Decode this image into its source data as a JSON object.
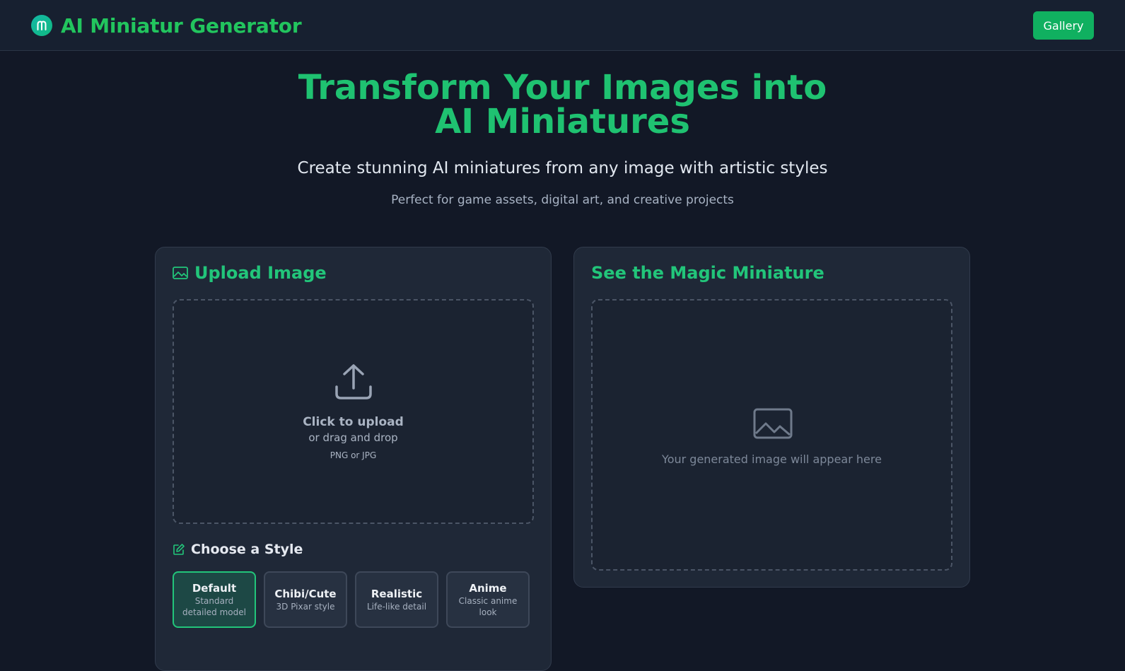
{
  "header": {
    "logo_icon": "m-logo-icon",
    "title": "AI Miniatur Generator",
    "gallery_label": "Gallery"
  },
  "hero": {
    "title_line1": "Transform Your Images into",
    "title_line2": "AI Miniatures",
    "subtitle": "Create stunning AI miniatures from any image with artistic styles",
    "tagline": "Perfect for game assets, digital art, and creative projects"
  },
  "upload_card": {
    "heading": "Upload Image",
    "heading_icon": "image-icon",
    "dropzone": {
      "icon": "upload-icon",
      "main_text": "Click to upload",
      "sub_text": "or drag and drop",
      "hint": "PNG or JPG"
    },
    "style_heading": "Choose a Style",
    "style_heading_icon": "edit-icon",
    "styles": [
      {
        "name": "Default",
        "desc": "Standard detailed model",
        "selected": true
      },
      {
        "name": "Chibi/Cute",
        "desc": "3D Pixar style",
        "selected": false
      },
      {
        "name": "Realistic",
        "desc": "Life-like detail",
        "selected": false
      },
      {
        "name": "Anime",
        "desc": "Classic anime look",
        "selected": false
      }
    ]
  },
  "result_card": {
    "heading_prefix": "See the ",
    "heading_highlight": "Magic Miniature",
    "placeholder_icon": "image-placeholder-icon",
    "placeholder_text": "Your generated image will appear here"
  },
  "colors": {
    "accent": "#22c55e",
    "background": "#121826",
    "card": "#1f2837",
    "button": "#10b060"
  }
}
